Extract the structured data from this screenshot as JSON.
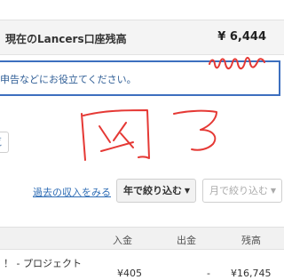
{
  "balance": {
    "label": "現在のLancers口座残高",
    "amount": "¥ 6,444"
  },
  "notice": {
    "text": "申告などにお役立てください。"
  },
  "view_link": {
    "text": "覧"
  },
  "filters": {
    "history_link": "過去の収入をみる",
    "year_select": "年で絞り込む",
    "month_select": "月で絞り込む"
  },
  "table": {
    "headers": {
      "deposit": "入金",
      "withdrawal": "出金",
      "balance": "残高"
    },
    "rows": [
      {
        "name": "！ - プロジェクト",
        "deposit": "¥405",
        "withdrawal": "-",
        "balance": "¥16,745"
      }
    ]
  },
  "annotation": {
    "handwriting_color": "#e53935"
  }
}
